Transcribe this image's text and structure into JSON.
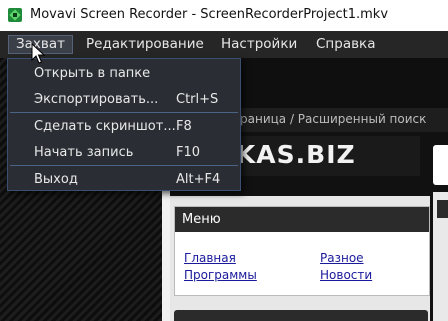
{
  "window": {
    "title": "Movavi Screen Recorder - ScreenRecorderProject1.mkv",
    "icon": "movavi-app-icon"
  },
  "menubar": {
    "items": [
      {
        "label": "Захват",
        "active": true
      },
      {
        "label": "Редактирование"
      },
      {
        "label": "Настройки"
      },
      {
        "label": "Справка"
      }
    ]
  },
  "capture_menu": {
    "items": [
      {
        "label": "Открыть в папке",
        "shortcut": ""
      },
      {
        "label": "Экспортировать...",
        "shortcut": "Ctrl+S"
      },
      {
        "label": "Сделать скриншот...",
        "shortcut": "F8"
      },
      {
        "label": "Начать запись",
        "shortcut": "F10"
      },
      {
        "label": "Выход",
        "shortcut": "Alt+F4"
      }
    ]
  },
  "background_page": {
    "breadcrumb": "раница / Расширенный поиск",
    "logo": "HKAS.BIZ",
    "menu_box": {
      "header": "Меню",
      "links": [
        "Главная",
        "Программы",
        "Разное",
        "Новости"
      ]
    }
  },
  "colors": {
    "menu_bg": "#2a2d33",
    "menu_border": "#3b5070",
    "menubar_bg": "#262626",
    "link": "#1a1a9c"
  }
}
